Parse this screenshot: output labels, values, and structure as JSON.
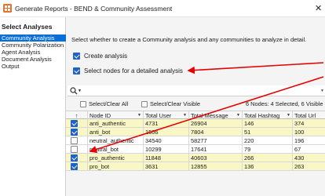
{
  "window": {
    "title": "Generate Reports - BEND & Community Assessment",
    "close_glyph": "✕",
    "icon": "app-logo-icon"
  },
  "sidebar": {
    "heading": "Select Analyses",
    "items": [
      {
        "label": "Community Analysis",
        "active": true
      },
      {
        "label": "Community Polarization",
        "active": false
      },
      {
        "label": "Agent Analysis",
        "active": false
      },
      {
        "label": "Document Analysis",
        "active": false
      },
      {
        "label": "Output",
        "active": false
      }
    ]
  },
  "main": {
    "description": "Select whether to create a Community analysis and any communities to analyze in detail.",
    "create_analysis_label": "Create analysis",
    "create_analysis_checked": true,
    "select_nodes_label": "Select nodes for a detailed analysis",
    "select_nodes_checked": true
  },
  "toolbar": {
    "select_all_label": "Select/Clear All",
    "select_visible_label": "Select/Clear Visible",
    "status": "6 Nodes: 4 Selected, 6 Visible"
  },
  "table": {
    "sort_glyph": "↑",
    "columns": [
      "Node ID",
      "Total User",
      "Total Message",
      "Total Hashtag",
      "Total Url"
    ],
    "rows": [
      {
        "checked": true,
        "node_id": "anti_authentic",
        "user": "4731",
        "message": "26904",
        "hashtag": "146",
        "url": "374"
      },
      {
        "checked": true,
        "node_id": "anti_bot",
        "user": "1506",
        "message": "7804",
        "hashtag": "51",
        "url": "100"
      },
      {
        "checked": false,
        "node_id": "neutral_authentic",
        "user": "34540",
        "message": "58277",
        "hashtag": "220",
        "url": "196"
      },
      {
        "checked": false,
        "node_id": "neutral_bot",
        "user": "10299",
        "message": "17641",
        "hashtag": "79",
        "url": "67"
      },
      {
        "checked": true,
        "node_id": "pro_authentic",
        "user": "11848",
        "message": "40603",
        "hashtag": "266",
        "url": "430"
      },
      {
        "checked": true,
        "node_id": "pro_bot",
        "user": "3631",
        "message": "12855",
        "hashtag": "136",
        "url": "263"
      }
    ]
  },
  "colors": {
    "accent": "#0a6fd8",
    "checkbox": "#1f63c7",
    "row_highlight": "#faf7c6",
    "annotation_arrow": "#e60000"
  }
}
